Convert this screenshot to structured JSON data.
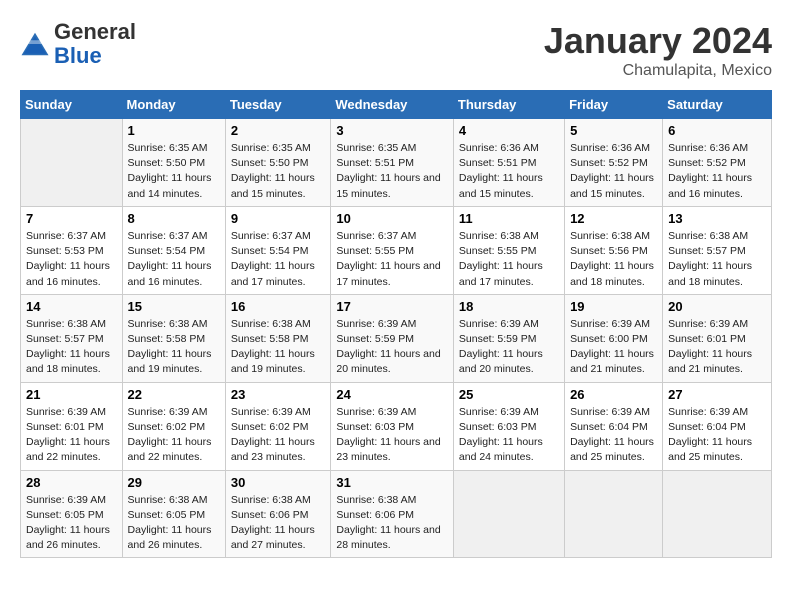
{
  "header": {
    "logo_general": "General",
    "logo_blue": "Blue",
    "month": "January 2024",
    "location": "Chamulapita, Mexico"
  },
  "days_of_week": [
    "Sunday",
    "Monday",
    "Tuesday",
    "Wednesday",
    "Thursday",
    "Friday",
    "Saturday"
  ],
  "weeks": [
    [
      {
        "day": "",
        "info": ""
      },
      {
        "day": "1",
        "info": "Sunrise: 6:35 AM\nSunset: 5:50 PM\nDaylight: 11 hours\nand 14 minutes."
      },
      {
        "day": "2",
        "info": "Sunrise: 6:35 AM\nSunset: 5:50 PM\nDaylight: 11 hours\nand 15 minutes."
      },
      {
        "day": "3",
        "info": "Sunrise: 6:35 AM\nSunset: 5:51 PM\nDaylight: 11 hours\nand 15 minutes."
      },
      {
        "day": "4",
        "info": "Sunrise: 6:36 AM\nSunset: 5:51 PM\nDaylight: 11 hours\nand 15 minutes."
      },
      {
        "day": "5",
        "info": "Sunrise: 6:36 AM\nSunset: 5:52 PM\nDaylight: 11 hours\nand 15 minutes."
      },
      {
        "day": "6",
        "info": "Sunrise: 6:36 AM\nSunset: 5:52 PM\nDaylight: 11 hours\nand 16 minutes."
      }
    ],
    [
      {
        "day": "7",
        "info": "Sunrise: 6:37 AM\nSunset: 5:53 PM\nDaylight: 11 hours\nand 16 minutes."
      },
      {
        "day": "8",
        "info": "Sunrise: 6:37 AM\nSunset: 5:54 PM\nDaylight: 11 hours\nand 16 minutes."
      },
      {
        "day": "9",
        "info": "Sunrise: 6:37 AM\nSunset: 5:54 PM\nDaylight: 11 hours\nand 17 minutes."
      },
      {
        "day": "10",
        "info": "Sunrise: 6:37 AM\nSunset: 5:55 PM\nDaylight: 11 hours\nand 17 minutes."
      },
      {
        "day": "11",
        "info": "Sunrise: 6:38 AM\nSunset: 5:55 PM\nDaylight: 11 hours\nand 17 minutes."
      },
      {
        "day": "12",
        "info": "Sunrise: 6:38 AM\nSunset: 5:56 PM\nDaylight: 11 hours\nand 18 minutes."
      },
      {
        "day": "13",
        "info": "Sunrise: 6:38 AM\nSunset: 5:57 PM\nDaylight: 11 hours\nand 18 minutes."
      }
    ],
    [
      {
        "day": "14",
        "info": "Sunrise: 6:38 AM\nSunset: 5:57 PM\nDaylight: 11 hours\nand 18 minutes."
      },
      {
        "day": "15",
        "info": "Sunrise: 6:38 AM\nSunset: 5:58 PM\nDaylight: 11 hours\nand 19 minutes."
      },
      {
        "day": "16",
        "info": "Sunrise: 6:38 AM\nSunset: 5:58 PM\nDaylight: 11 hours\nand 19 minutes."
      },
      {
        "day": "17",
        "info": "Sunrise: 6:39 AM\nSunset: 5:59 PM\nDaylight: 11 hours\nand 20 minutes."
      },
      {
        "day": "18",
        "info": "Sunrise: 6:39 AM\nSunset: 5:59 PM\nDaylight: 11 hours\nand 20 minutes."
      },
      {
        "day": "19",
        "info": "Sunrise: 6:39 AM\nSunset: 6:00 PM\nDaylight: 11 hours\nand 21 minutes."
      },
      {
        "day": "20",
        "info": "Sunrise: 6:39 AM\nSunset: 6:01 PM\nDaylight: 11 hours\nand 21 minutes."
      }
    ],
    [
      {
        "day": "21",
        "info": "Sunrise: 6:39 AM\nSunset: 6:01 PM\nDaylight: 11 hours\nand 22 minutes."
      },
      {
        "day": "22",
        "info": "Sunrise: 6:39 AM\nSunset: 6:02 PM\nDaylight: 11 hours\nand 22 minutes."
      },
      {
        "day": "23",
        "info": "Sunrise: 6:39 AM\nSunset: 6:02 PM\nDaylight: 11 hours\nand 23 minutes."
      },
      {
        "day": "24",
        "info": "Sunrise: 6:39 AM\nSunset: 6:03 PM\nDaylight: 11 hours\nand 23 minutes."
      },
      {
        "day": "25",
        "info": "Sunrise: 6:39 AM\nSunset: 6:03 PM\nDaylight: 11 hours\nand 24 minutes."
      },
      {
        "day": "26",
        "info": "Sunrise: 6:39 AM\nSunset: 6:04 PM\nDaylight: 11 hours\nand 25 minutes."
      },
      {
        "day": "27",
        "info": "Sunrise: 6:39 AM\nSunset: 6:04 PM\nDaylight: 11 hours\nand 25 minutes."
      }
    ],
    [
      {
        "day": "28",
        "info": "Sunrise: 6:39 AM\nSunset: 6:05 PM\nDaylight: 11 hours\nand 26 minutes."
      },
      {
        "day": "29",
        "info": "Sunrise: 6:38 AM\nSunset: 6:05 PM\nDaylight: 11 hours\nand 26 minutes."
      },
      {
        "day": "30",
        "info": "Sunrise: 6:38 AM\nSunset: 6:06 PM\nDaylight: 11 hours\nand 27 minutes."
      },
      {
        "day": "31",
        "info": "Sunrise: 6:38 AM\nSunset: 6:06 PM\nDaylight: 11 hours\nand 28 minutes."
      },
      {
        "day": "",
        "info": ""
      },
      {
        "day": "",
        "info": ""
      },
      {
        "day": "",
        "info": ""
      }
    ]
  ]
}
